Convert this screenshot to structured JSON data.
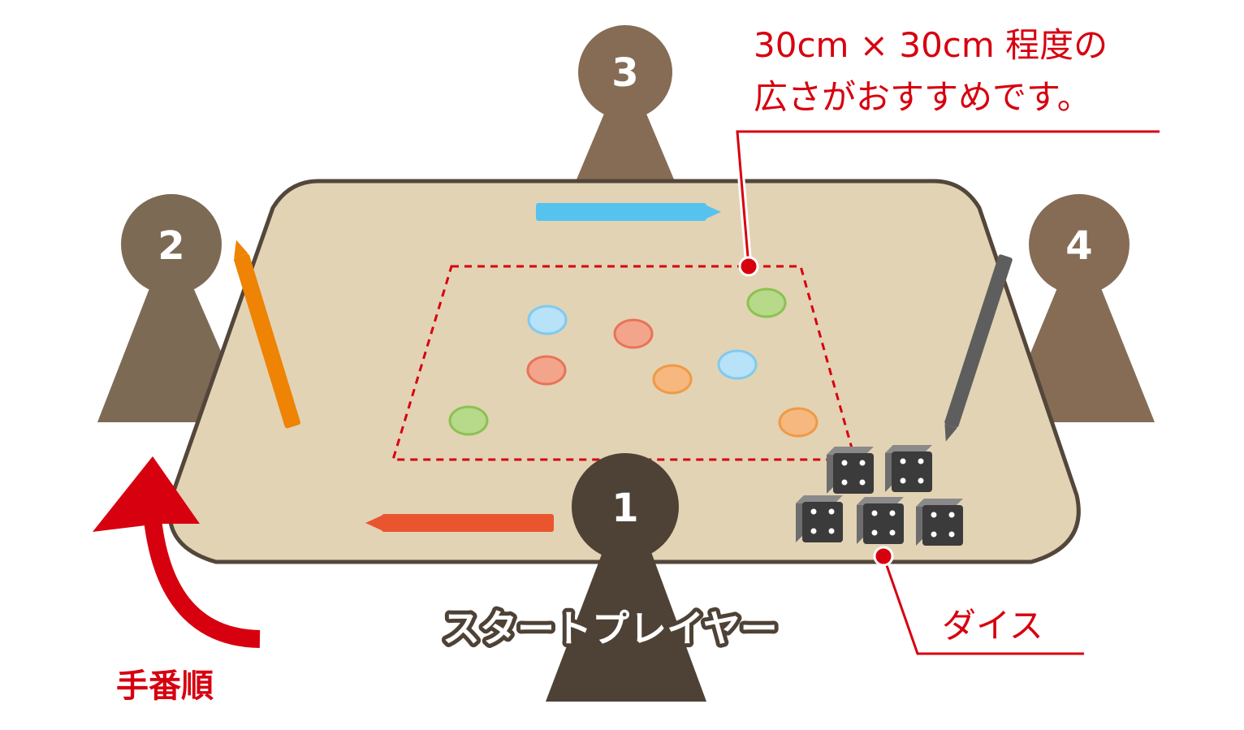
{
  "players": [
    {
      "number": "1",
      "color": "#4e4236"
    },
    {
      "number": "2",
      "color": "#7d6a55"
    },
    {
      "number": "3",
      "color": "#866c55"
    },
    {
      "number": "4",
      "color": "#866c55"
    }
  ],
  "annotations": {
    "area_line1": "30cm × 30cm 程度の",
    "area_line2": "広さがおすすめです。",
    "dice_label": "ダイス",
    "start_player": "スタートプレイヤー",
    "turn_order": "手番順"
  },
  "colors": {
    "table": "#e2d3b4",
    "table_edge": "#53463a",
    "accent_red": "#d7000f",
    "pen_blue": "#55c3ee",
    "pen_orange": "#ee8304",
    "pen_red": "#e9552f",
    "pen_gray": "#5e5e5e",
    "chip_blue": "#b7e2f8",
    "chip_salmon": "#f2a58a",
    "chip_orange": "#f6b87e",
    "chip_green": "#b6d98a",
    "die": "#3b3b3b"
  },
  "chips": [
    {
      "color": "blue"
    },
    {
      "color": "salmon"
    },
    {
      "color": "green"
    },
    {
      "color": "salmon"
    },
    {
      "color": "orange"
    },
    {
      "color": "blue"
    },
    {
      "color": "green"
    },
    {
      "color": "orange"
    }
  ],
  "dice_count": 5
}
